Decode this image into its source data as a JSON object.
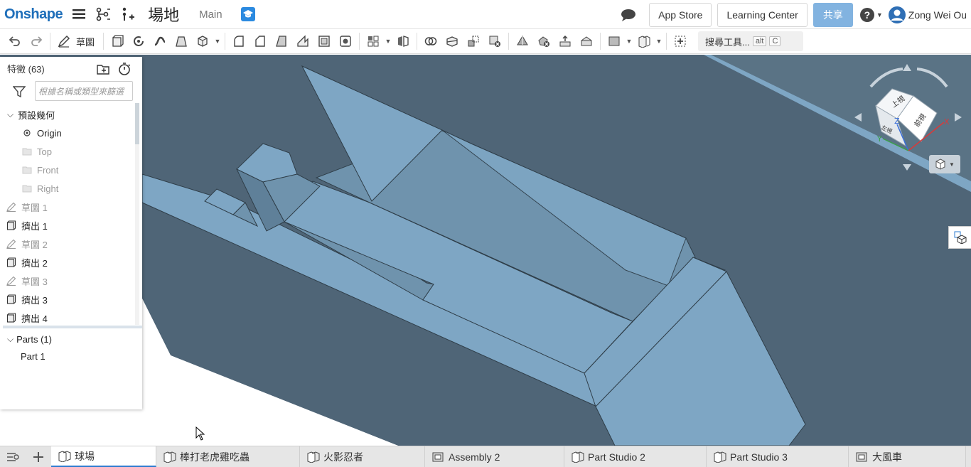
{
  "header": {
    "logo": "Onshape",
    "document_name": "場地",
    "workspace": "Main",
    "app_store": "App Store",
    "learning_center": "Learning Center",
    "share": "共享",
    "help": "?",
    "user_name": "Zong Wei Ou"
  },
  "toolbar": {
    "sketch_label": "草圖",
    "search_tools": "搜尋工具...",
    "search_shortcut_alt": "alt",
    "search_shortcut_key": "C"
  },
  "panel": {
    "title": "特徵 (63)",
    "filter_placeholder": "根據名稱或類型來篩選",
    "default_geometry": "預設幾何",
    "items": [
      {
        "label": "Origin",
        "icon": "origin-icon",
        "dim": false
      },
      {
        "label": "Top",
        "icon": "plane-icon",
        "dim": true
      },
      {
        "label": "Front",
        "icon": "plane-icon",
        "dim": true
      },
      {
        "label": "Right",
        "icon": "plane-icon",
        "dim": true
      },
      {
        "label": "草圖 1",
        "icon": "sketch-icon",
        "dim": true
      },
      {
        "label": "擠出 1",
        "icon": "extrude-icon",
        "dim": false
      },
      {
        "label": "草圖 2",
        "icon": "sketch-icon",
        "dim": true
      },
      {
        "label": "擠出 2",
        "icon": "extrude-icon",
        "dim": false
      },
      {
        "label": "草圖 3",
        "icon": "sketch-icon",
        "dim": true
      },
      {
        "label": "擠出 3",
        "icon": "extrude-icon",
        "dim": false
      },
      {
        "label": "擠出 4",
        "icon": "extrude-icon",
        "dim": false
      }
    ],
    "parts_label": "Parts (1)",
    "parts": [
      "Part 1"
    ]
  },
  "viewcube": {
    "top": "上視",
    "front": "前視",
    "left": "左視",
    "axis_x": "X",
    "axis_y": "Y",
    "axis_z": "Z"
  },
  "tabs": [
    {
      "label": "球場",
      "icon": "part-studio-icon",
      "active": true
    },
    {
      "label": "棒打老虎雞吃蟲",
      "icon": "part-studio-icon",
      "active": false
    },
    {
      "label": "火影忍者",
      "icon": "part-studio-icon",
      "active": false
    },
    {
      "label": "Assembly 2",
      "icon": "assembly-icon",
      "active": false
    },
    {
      "label": "Part Studio 2",
      "icon": "part-studio-icon",
      "active": false
    },
    {
      "label": "Part Studio 3",
      "icon": "part-studio-icon",
      "active": false
    },
    {
      "label": "大風車",
      "icon": "assembly-icon",
      "active": false
    }
  ],
  "colors": {
    "brand": "#1f6fba",
    "viewport_bg": "#4f6577",
    "part_face": "#7ea6c4",
    "part_face_dark": "#6f93ad",
    "share_button": "#82b3e0"
  }
}
